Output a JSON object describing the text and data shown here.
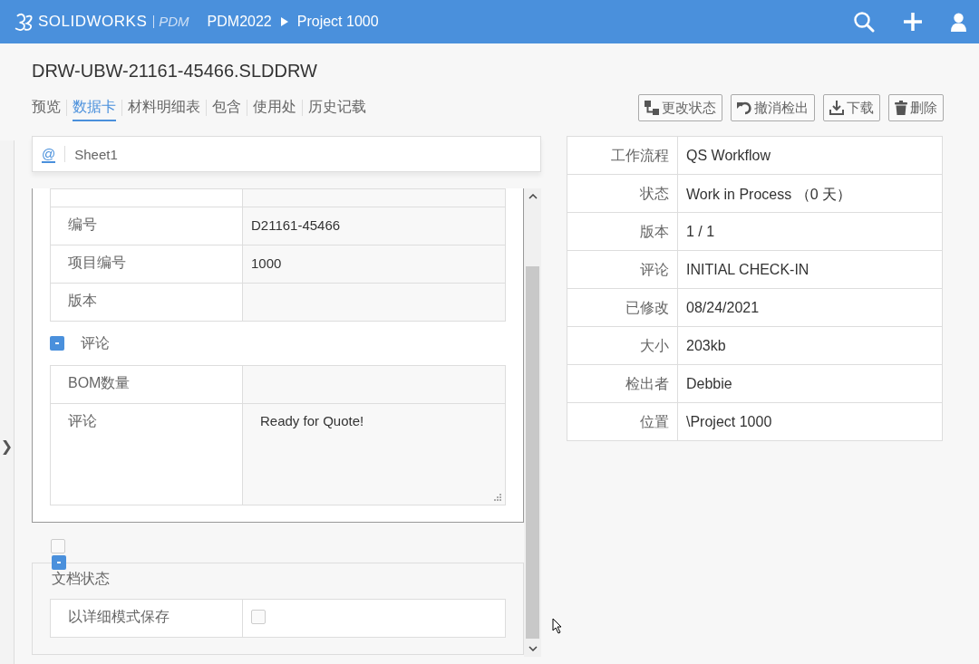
{
  "header": {
    "brand": "**SOLID**WORKS",
    "product": "PDM",
    "breadcrumb": [
      "PDM2022",
      "Project 1000"
    ]
  },
  "file_title": "DRW-UBW-21161-45466.SLDDRW",
  "tabs": [
    {
      "label": "预览",
      "selected": false
    },
    {
      "label": "数据卡",
      "selected": true
    },
    {
      "label": "材料明细表",
      "selected": false
    },
    {
      "label": "包含",
      "selected": false
    },
    {
      "label": "使用处",
      "selected": false
    },
    {
      "label": "历史记载",
      "selected": false
    }
  ],
  "actions": [
    {
      "label": "更改状态",
      "kind": "workflow"
    },
    {
      "label": "撤消检出",
      "kind": "undo"
    },
    {
      "label": "下载",
      "kind": "download"
    },
    {
      "label": "删除",
      "kind": "delete"
    }
  ],
  "sidebar_toggle": "❯",
  "sheet_tabs": [
    {
      "label": "@",
      "selected": true
    },
    {
      "label": "Sheet1",
      "selected": false
    }
  ],
  "card": {
    "fields": [
      {
        "label": "编号",
        "value": "D21161-45466"
      },
      {
        "label": "项目编号",
        "value": "1000"
      },
      {
        "label": "版本"
      }
    ],
    "comment_group": {
      "title": "评论",
      "expanded": true,
      "fields": [
        {
          "label": "BOM数量",
          "kind": "text"
        },
        {
          "label": "评论",
          "value": "Ready for Quote!",
          "kind": "textarea"
        }
      ]
    },
    "loose_checkbox": {
      "checked": false
    },
    "doc_state": {
      "title": "文档状态",
      "expanded": true,
      "fields": [
        {
          "label": "以详细模式保存",
          "kind": "checkbox",
          "checked": false
        }
      ]
    }
  },
  "properties": [
    {
      "label": "工作流程",
      "value": "QS Workflow"
    },
    {
      "label": "状态",
      "value": "Work in Process （0 天）"
    },
    {
      "label": "版本",
      "value": "1 / 1"
    },
    {
      "label": "评论",
      "value": "INITIAL CHECK-IN"
    },
    {
      "label": "已修改",
      "value": "08/24/2021"
    },
    {
      "label": "大小",
      "value": "203kb"
    },
    {
      "label": "检出者",
      "value": "Debbie"
    },
    {
      "label": "位置",
      "value": "\\Project 1000"
    }
  ]
}
